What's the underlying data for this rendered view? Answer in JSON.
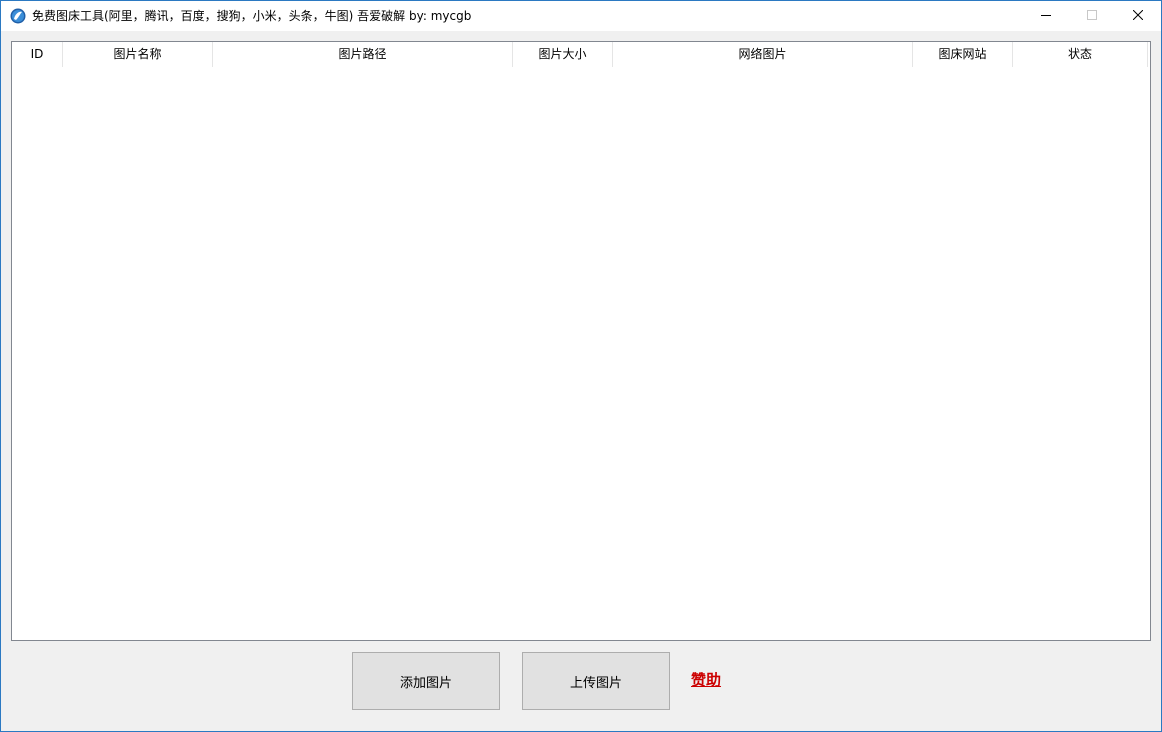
{
  "window": {
    "title": "免费图床工具(阿里，腾讯，百度，搜狗，小米，头条，牛图) 吾爱破解 by: mycgb",
    "icon": "app-icon",
    "controls": {
      "minimize_icon": "minimize-icon",
      "maximize_icon": "maximize-icon",
      "close_icon": "close-icon"
    }
  },
  "table": {
    "columns": [
      {
        "key": "id",
        "label": "ID"
      },
      {
        "key": "name",
        "label": "图片名称"
      },
      {
        "key": "path",
        "label": "图片路径"
      },
      {
        "key": "size",
        "label": "图片大小"
      },
      {
        "key": "url",
        "label": "网络图片"
      },
      {
        "key": "site",
        "label": "图床网站"
      },
      {
        "key": "status",
        "label": "状态"
      }
    ],
    "rows": []
  },
  "actions": {
    "add_label": "添加图片",
    "upload_label": "上传图片",
    "sponsor_label": "赞助"
  },
  "colors": {
    "accent_border": "#2b79c2",
    "sponsor": "#cc0000",
    "button_bg": "#e1e1e1"
  }
}
